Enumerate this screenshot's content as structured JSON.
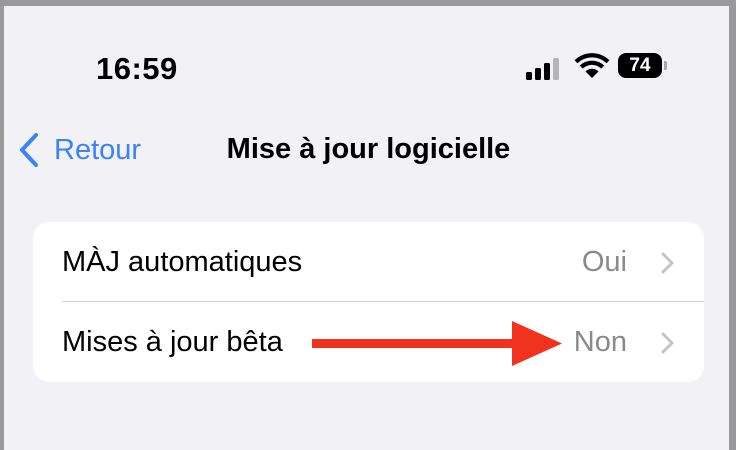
{
  "status_bar": {
    "time": "16:59",
    "battery_level": "74",
    "signal_bars_active": 3,
    "signal_bars_total": 4,
    "icons": [
      "cellular-signal-icon",
      "wifi-icon",
      "battery-icon"
    ]
  },
  "nav": {
    "back_label": "Retour",
    "title": "Mise à jour logicielle",
    "back_icon": "chevron-left-icon"
  },
  "settings": {
    "rows": [
      {
        "label": "MÀJ automatiques",
        "value": "Oui"
      },
      {
        "label": "Mises à jour bêta",
        "value": "Non"
      }
    ],
    "row_icon": "chevron-right-icon"
  },
  "annotation": {
    "arrow_icon": "red-arrow-icon",
    "color": "#f0321e"
  },
  "colors": {
    "background": "#f2f1f6",
    "accent": "#3b82f6",
    "secondary_text": "#8a8a8e",
    "card": "#ffffff"
  }
}
